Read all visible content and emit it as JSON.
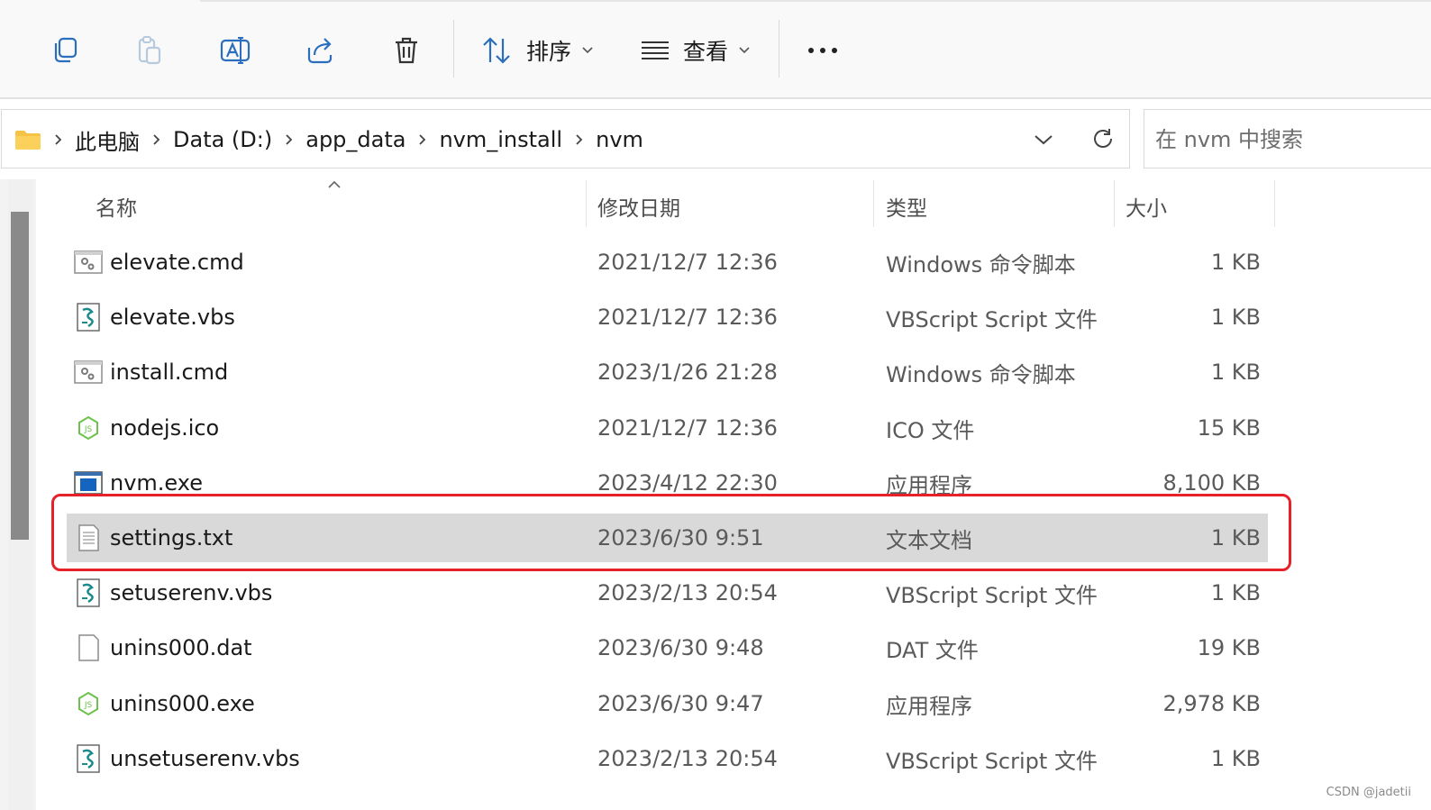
{
  "toolbar": {
    "sort_label": "排序",
    "view_label": "查看",
    "icons": [
      "copy-icon",
      "paste-icon",
      "rename-icon",
      "share-icon",
      "delete-icon",
      "sort-icon",
      "view-icon",
      "more-icon"
    ]
  },
  "address": {
    "crumbs": [
      "此电脑",
      "Data (D:)",
      "app_data",
      "nvm_install",
      "nvm"
    ],
    "search_placeholder": "在 nvm 中搜索"
  },
  "columns": {
    "name": "名称",
    "date": "修改日期",
    "type": "类型",
    "size": "大小"
  },
  "files": [
    {
      "name": "elevate.cmd",
      "date": "2021/12/7 12:36",
      "type": "Windows 命令脚本",
      "size": "1 KB",
      "icon": "cmd-file-icon"
    },
    {
      "name": "elevate.vbs",
      "date": "2021/12/7 12:36",
      "type": "VBScript Script 文件",
      "size": "1 KB",
      "icon": "vbs-file-icon"
    },
    {
      "name": "install.cmd",
      "date": "2023/1/26 21:28",
      "type": "Windows 命令脚本",
      "size": "1 KB",
      "icon": "cmd-file-icon"
    },
    {
      "name": "nodejs.ico",
      "date": "2021/12/7 12:36",
      "type": "ICO 文件",
      "size": "15 KB",
      "icon": "nodejs-icon"
    },
    {
      "name": "nvm.exe",
      "date": "2023/4/12 22:30",
      "type": "应用程序",
      "size": "8,100 KB",
      "icon": "exe-file-icon"
    },
    {
      "name": "settings.txt",
      "date": "2023/6/30 9:51",
      "type": "文本文档",
      "size": "1 KB",
      "icon": "text-file-icon",
      "selected": true
    },
    {
      "name": "setuserenv.vbs",
      "date": "2023/2/13 20:54",
      "type": "VBScript Script 文件",
      "size": "1 KB",
      "icon": "vbs-file-icon"
    },
    {
      "name": "unins000.dat",
      "date": "2023/6/30 9:48",
      "type": "DAT 文件",
      "size": "19 KB",
      "icon": "blank-file-icon"
    },
    {
      "name": "unins000.exe",
      "date": "2023/6/30 9:47",
      "type": "应用程序",
      "size": "2,978 KB",
      "icon": "nodejs-icon"
    },
    {
      "name": "unsetuserenv.vbs",
      "date": "2023/2/13 20:54",
      "type": "VBScript Script 文件",
      "size": "1 KB",
      "icon": "vbs-file-icon"
    }
  ],
  "watermark": "CSDN @jadetii"
}
